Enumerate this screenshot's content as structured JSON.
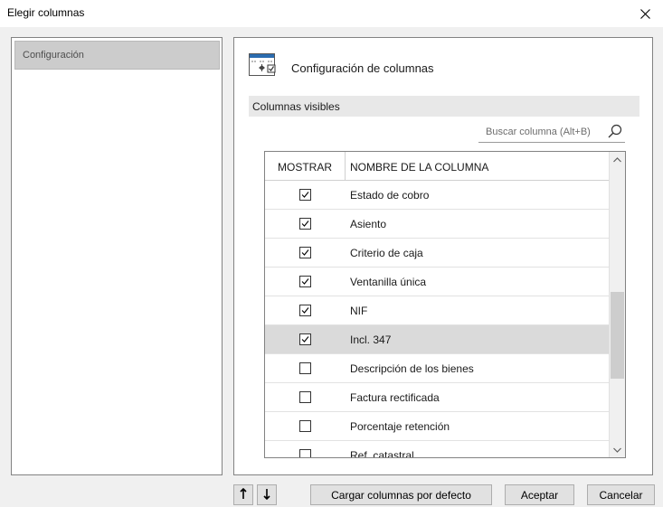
{
  "window": {
    "title": "Elegir columnas"
  },
  "sidebar": {
    "items": [
      {
        "label": "Configuración",
        "selected": true
      }
    ]
  },
  "main": {
    "header_title": "Configuración de columnas",
    "section_label": "Columnas visibles",
    "search": {
      "placeholder": "Buscar columna (Alt+B)",
      "value": ""
    },
    "table": {
      "headers": {
        "show": "MOSTRAR",
        "name": "NOMBRE DE LA COLUMNA"
      },
      "rows": [
        {
          "name": "Estado de cobro",
          "checked": true,
          "selected": false
        },
        {
          "name": "Asiento",
          "checked": true,
          "selected": false
        },
        {
          "name": "Criterio de caja",
          "checked": true,
          "selected": false
        },
        {
          "name": "Ventanilla única",
          "checked": true,
          "selected": false
        },
        {
          "name": "NIF",
          "checked": true,
          "selected": false
        },
        {
          "name": "Incl. 347",
          "checked": true,
          "selected": true
        },
        {
          "name": "Descripción de los bienes",
          "checked": false,
          "selected": false
        },
        {
          "name": "Factura rectificada",
          "checked": false,
          "selected": false
        },
        {
          "name": "Porcentaje retención",
          "checked": false,
          "selected": false
        },
        {
          "name": "Ref. catastral",
          "checked": false,
          "selected": false
        }
      ]
    }
  },
  "footer": {
    "move_up_icon": "arrow-up-icon",
    "move_down_icon": "arrow-down-icon",
    "load_defaults_label": "Cargar columnas por defecto",
    "ok_label": "Aceptar",
    "cancel_label": "Cancelar"
  },
  "colors": {
    "selected_row": "#dadada",
    "nav_selected": "#cccccc",
    "section_bar": "#e8e8e8"
  }
}
